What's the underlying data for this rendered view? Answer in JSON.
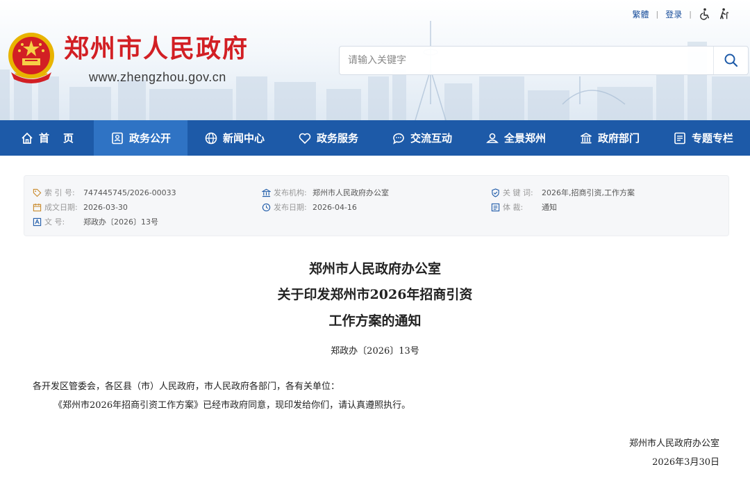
{
  "header": {
    "top_links": {
      "traditional": "繁體",
      "login": "登录"
    },
    "site_title": "郑州市人民政府",
    "site_url": "www.zhengzhou.gov.cn",
    "search_placeholder": "请输入关键字"
  },
  "nav": [
    {
      "label": "首页",
      "icon": "home-icon"
    },
    {
      "label": "政务公开",
      "icon": "id-card-icon",
      "active": true
    },
    {
      "label": "新闻中心",
      "icon": "globe-icon"
    },
    {
      "label": "政务服务",
      "icon": "heart-icon"
    },
    {
      "label": "交流互动",
      "icon": "chat-icon"
    },
    {
      "label": "全景郑州",
      "icon": "panorama-icon"
    },
    {
      "label": "政府部门",
      "icon": "building-icon"
    },
    {
      "label": "专题专栏",
      "icon": "list-icon"
    }
  ],
  "info": {
    "index_label": "索 引 号:",
    "index_value": "747445745/2026-00033",
    "publisher_label": "发布机构:",
    "publisher_value": "郑州市人民政府办公室",
    "keywords_label": "关 键 词:",
    "keywords_value": "2026年,招商引资,工作方案",
    "created_label": "成文日期:",
    "created_value": "2026-03-30",
    "published_label": "发布日期:",
    "published_value": "2026-04-16",
    "genre_label": "体      裁:",
    "genre_value": "通知",
    "docno_label": "文      号:",
    "docno_value": "郑政办〔2026〕13号"
  },
  "article": {
    "title_line1": "郑州市人民政府办公室",
    "title_line2": "关于印发郑州市2026年招商引资",
    "title_line3": "工作方案的通知",
    "doc_no": "郑政办〔2026〕13号",
    "recipients": "各开发区管委会，各区县（市）人民政府，市人民政府各部门，各有关单位：",
    "body": "《郑州市2026年招商引资工作方案》已经市政府同意，现印发给你们，请认真遵照执行。",
    "signature": "郑州市人民政府办公室",
    "date": "2026年3月30日"
  },
  "colors": {
    "brand_red": "#d21f24",
    "nav_blue": "#1d5aa8",
    "nav_active": "#2f73c4",
    "link_blue": "#1a4f9c"
  }
}
